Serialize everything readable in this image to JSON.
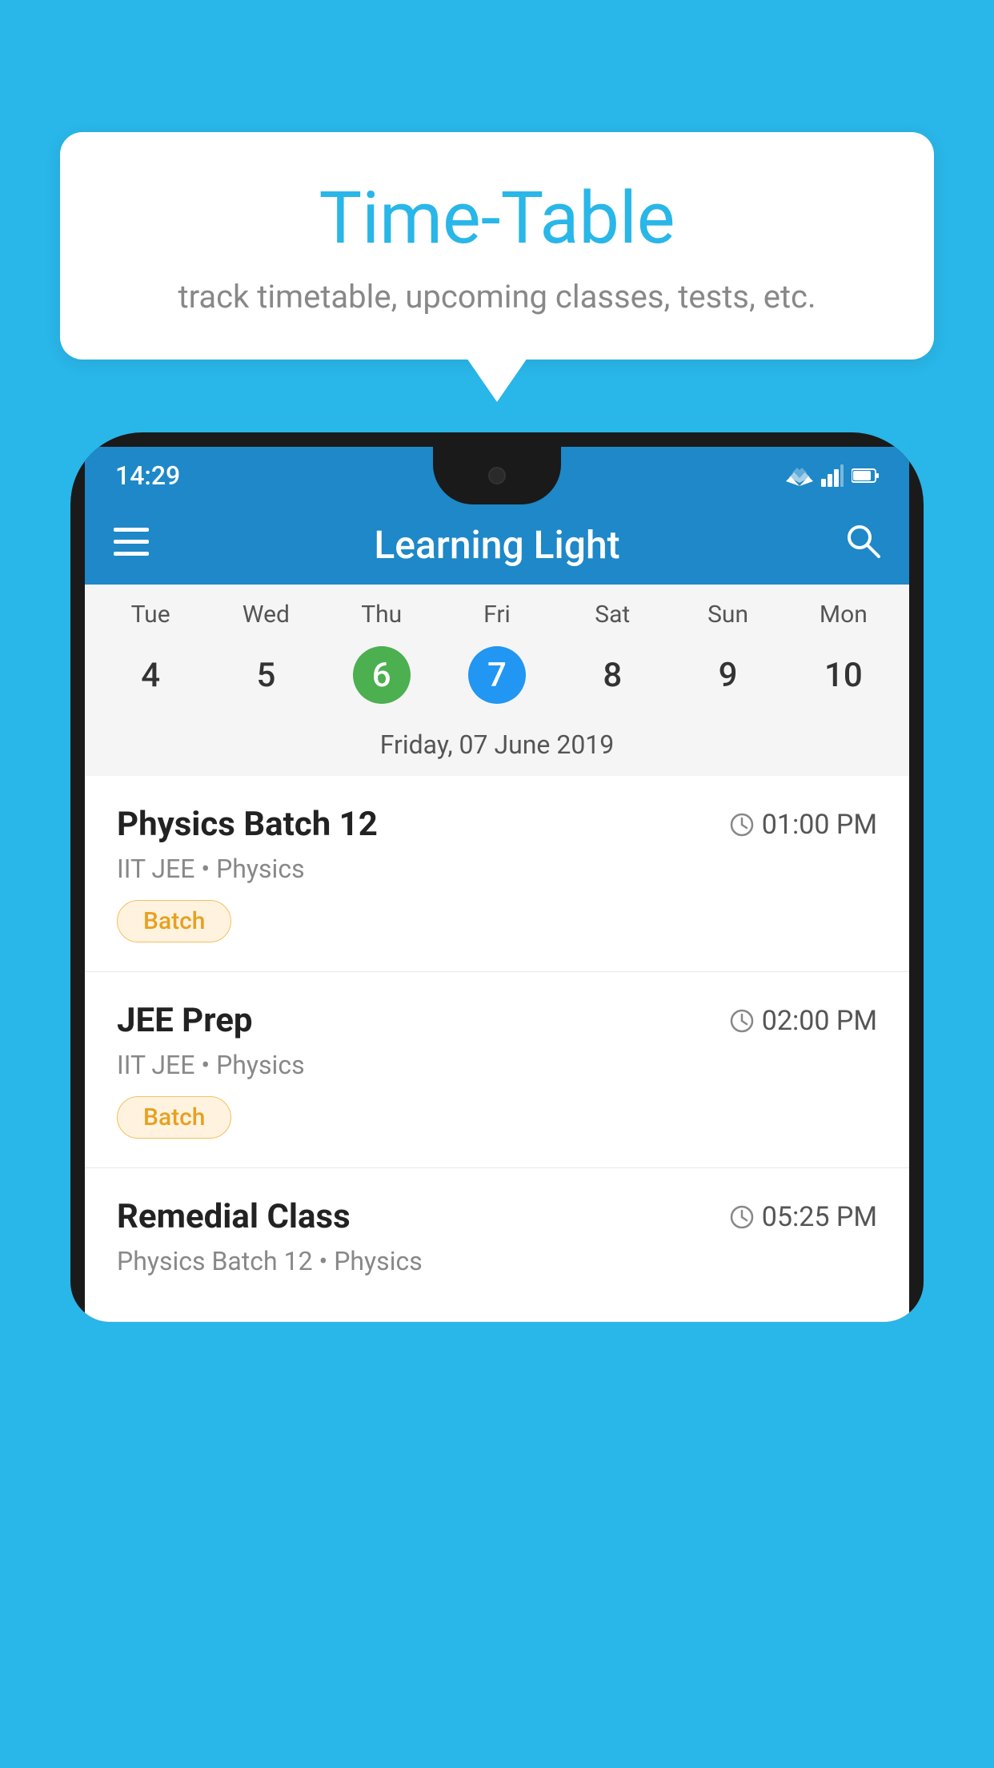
{
  "background_color": "#29B6E8",
  "speech_bubble": {
    "title": "Time-Table",
    "subtitle": "track timetable, upcoming classes, tests, etc."
  },
  "phone": {
    "status_bar": {
      "time": "14:29",
      "icons": [
        "wifi",
        "signal",
        "battery"
      ]
    },
    "app_bar": {
      "title": "Learning Light",
      "menu_icon": "☰",
      "search_icon": "🔍"
    },
    "calendar": {
      "days": [
        "Tue",
        "Wed",
        "Thu",
        "Fri",
        "Sat",
        "Sun",
        "Mon"
      ],
      "dates": [
        "4",
        "5",
        "6",
        "7",
        "8",
        "9",
        "10"
      ],
      "today_index": 2,
      "selected_index": 3,
      "selected_date_label": "Friday, 07 June 2019"
    },
    "classes": [
      {
        "name": "Physics Batch 12",
        "time": "01:00 PM",
        "meta": "IIT JEE • Physics",
        "tag": "Batch"
      },
      {
        "name": "JEE Prep",
        "time": "02:00 PM",
        "meta": "IIT JEE • Physics",
        "tag": "Batch"
      },
      {
        "name": "Remedial Class",
        "time": "05:25 PM",
        "meta": "Physics Batch 12 • Physics",
        "tag": ""
      }
    ]
  }
}
